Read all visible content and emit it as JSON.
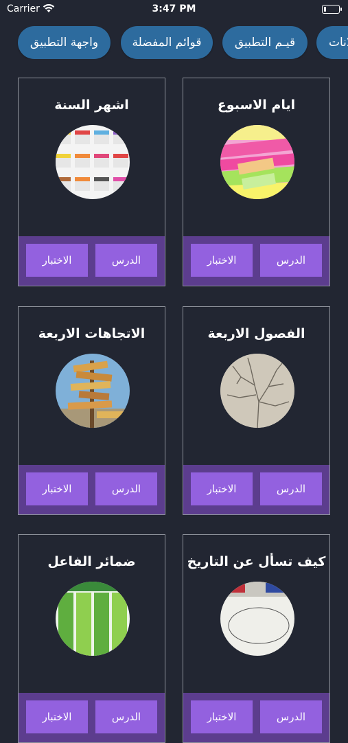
{
  "status": {
    "carrier": "Carrier",
    "time": "3:47 PM"
  },
  "tabs": [
    {
      "label": "واجهة التطبيق"
    },
    {
      "label": "قوائم المفضلة"
    },
    {
      "label": "قيـم التطبيق"
    },
    {
      "label": "لانات"
    }
  ],
  "cards": [
    {
      "title": "ايام الاسبوع",
      "lesson": "الدرس",
      "test": "الاختبار"
    },
    {
      "title": "اشهر السنة",
      "lesson": "الدرس",
      "test": "الاختبار"
    },
    {
      "title": "الفصول الاربعة",
      "lesson": "الدرس",
      "test": "الاختبار"
    },
    {
      "title": "الاتجاهات الاربعة",
      "lesson": "الدرس",
      "test": "الاختبار"
    },
    {
      "title": "كيف تسأل عن التاريخ",
      "lesson": "الدرس",
      "test": "الاختبار"
    },
    {
      "title": "ضمائر الفاعل",
      "lesson": "الدرس",
      "test": "الاختبار"
    }
  ],
  "colors": {
    "background": "#222632",
    "tab": "#2d6b9e",
    "footer": "#5c3d8e",
    "button": "#9361df"
  }
}
